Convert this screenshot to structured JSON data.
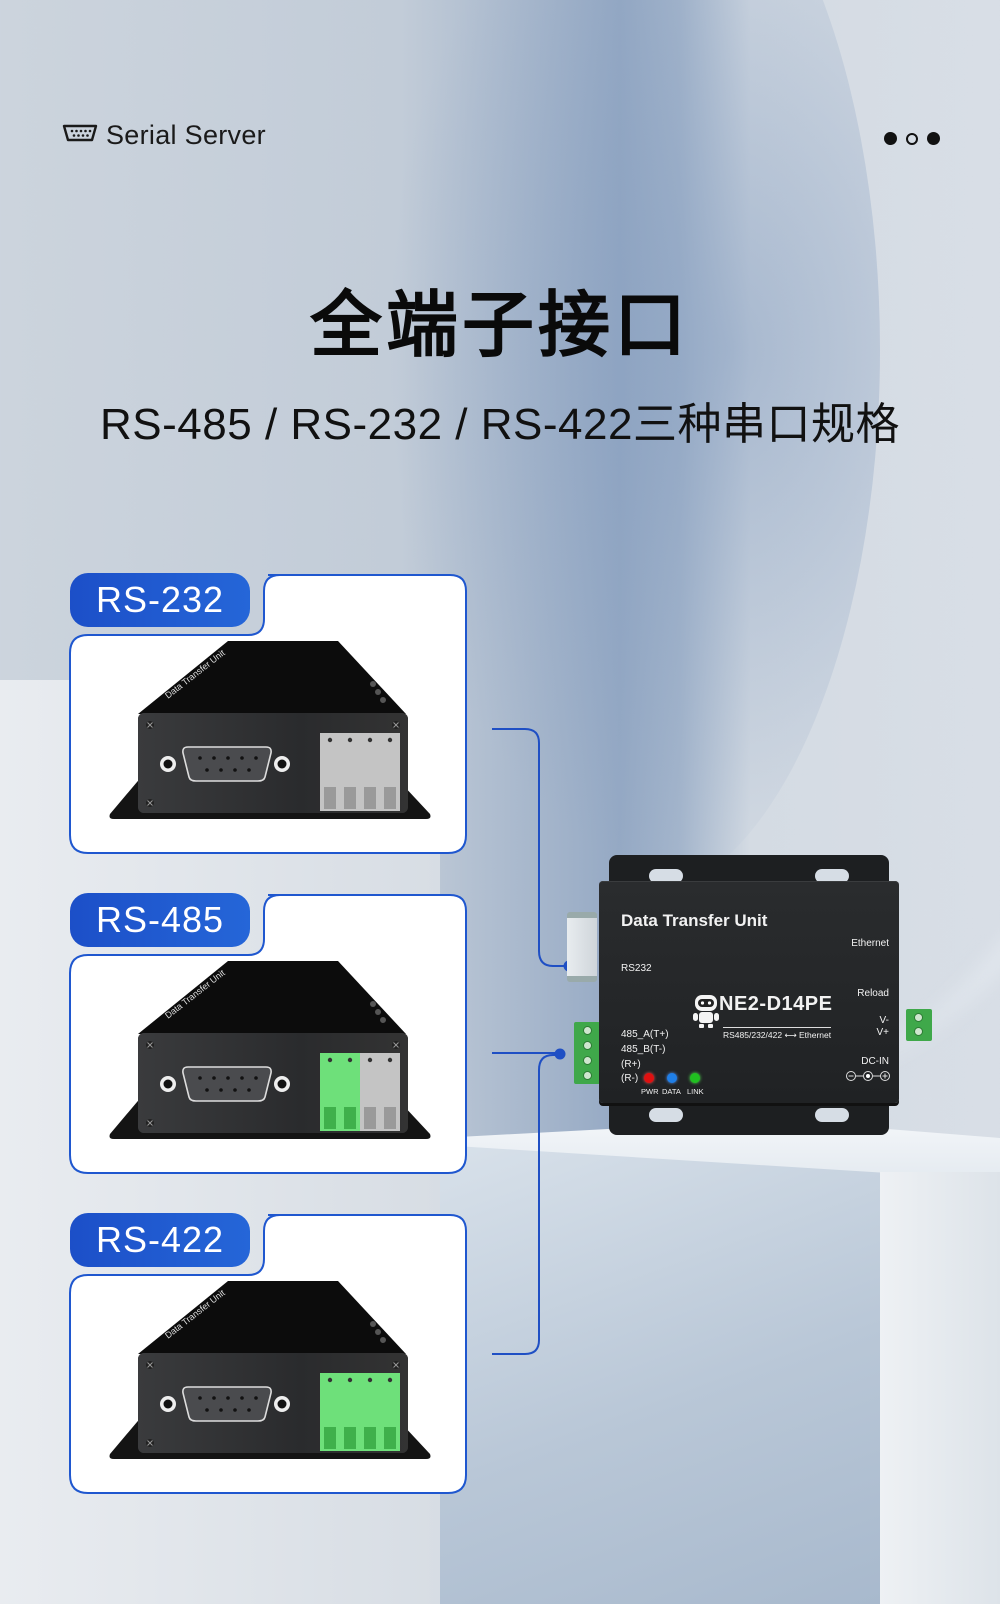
{
  "header": {
    "brand_icon": "serial-port-icon",
    "brand_label": "Serial Server",
    "pager": {
      "total": 3,
      "active_index": 1
    }
  },
  "hero": {
    "title": "全端子接口",
    "subtitle": "RS-485 / RS-232 / RS-422三种串口规格"
  },
  "colors": {
    "accent_blue": "#1f57cf",
    "terminal_green": "#6ee07a",
    "terminal_gray": "#b8b8b8",
    "device_body": "#222426",
    "led_pwr": "#e01010",
    "led_data": "#1f7fe8",
    "led_link": "#20c020"
  },
  "cards": [
    {
      "label": "RS-232",
      "terminal_colors": [
        "gray",
        "gray",
        "gray",
        "gray"
      ]
    },
    {
      "label": "RS-485",
      "terminal_colors": [
        "green",
        "green",
        "gray",
        "gray"
      ]
    },
    {
      "label": "RS-422",
      "terminal_colors": [
        "green",
        "green",
        "green",
        "green"
      ]
    }
  ],
  "device_thumbnail": {
    "top_label": "Data Transfer Unit",
    "port_label": "RS232"
  },
  "main_device": {
    "title": "Data Transfer Unit",
    "rs232_label": "RS232",
    "ethernet_label": "Ethernet",
    "reload_label": "Reload",
    "model": "NE2-D14PE",
    "model_sub": "RS485/232/422 ⟷ Ethernet",
    "terminal_labels": [
      "485_A(T+)",
      "485_B(T-)",
      "(R+)",
      "(R-)"
    ],
    "power_labels": [
      "V-",
      "V+"
    ],
    "dc_in_label": "DC-IN",
    "leds": [
      {
        "label": "PWR",
        "color": "#e01010"
      },
      {
        "label": "DATA",
        "color": "#1f7fe8"
      },
      {
        "label": "LINK",
        "color": "#20c020"
      }
    ]
  }
}
